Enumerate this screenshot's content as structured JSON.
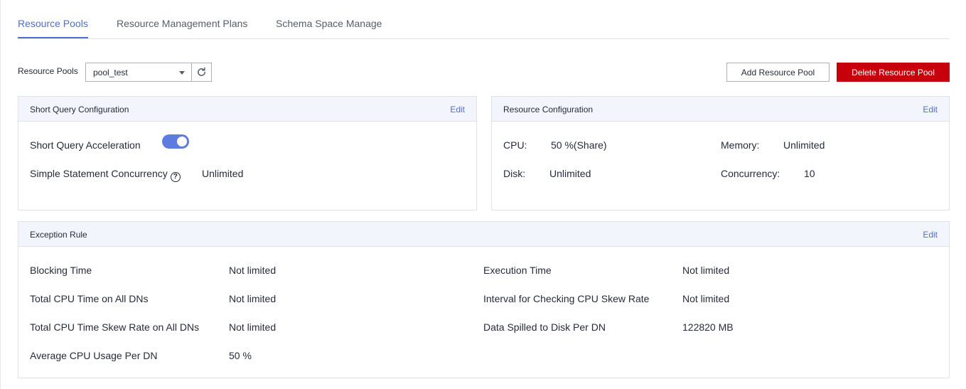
{
  "tabs": [
    {
      "label": "Resource Pools",
      "active": true
    },
    {
      "label": "Resource Management Plans",
      "active": false
    },
    {
      "label": "Schema Space Manage",
      "active": false
    }
  ],
  "toolbar": {
    "pool_label": "Resource Pools",
    "pool_value": "pool_test",
    "add_label": "Add Resource Pool",
    "delete_label": "Delete Resource Pool"
  },
  "short_query": {
    "title": "Short Query Configuration",
    "edit_label": "Edit",
    "acceleration_label": "Short Query Acceleration",
    "acceleration_enabled": true,
    "concurrency_label": "Simple Statement Concurrency",
    "concurrency_value": "Unlimited"
  },
  "resource_config": {
    "title": "Resource Configuration",
    "edit_label": "Edit",
    "cpu_label": "CPU:",
    "cpu_value": "50 %(Share)",
    "memory_label": "Memory:",
    "memory_value": "Unlimited",
    "disk_label": "Disk:",
    "disk_value": "Unlimited",
    "concurrency_label": "Concurrency:",
    "concurrency_value": "10"
  },
  "exception_rule": {
    "title": "Exception Rule",
    "edit_label": "Edit",
    "left": [
      {
        "label": "Blocking Time",
        "value": "Not limited"
      },
      {
        "label": "Total CPU Time on All DNs",
        "value": "Not limited"
      },
      {
        "label": "Total CPU Time Skew Rate on All DNs",
        "value": "Not limited"
      },
      {
        "label": "Average CPU Usage Per DN",
        "value": "50 %"
      }
    ],
    "right": [
      {
        "label": "Execution Time",
        "value": "Not limited"
      },
      {
        "label": "Interval for Checking CPU Skew Rate",
        "value": "Not limited"
      },
      {
        "label": "Data Spilled to Disk Per DN",
        "value": "122820 MB"
      }
    ]
  },
  "colors": {
    "accent": "#526ecc",
    "toggle_on": "#5e7ce0",
    "danger": "#c7000b",
    "panel_header": "#f3f5fc"
  },
  "icons": [
    "chevron-down-icon",
    "refresh-icon",
    "help-circle-icon"
  ]
}
